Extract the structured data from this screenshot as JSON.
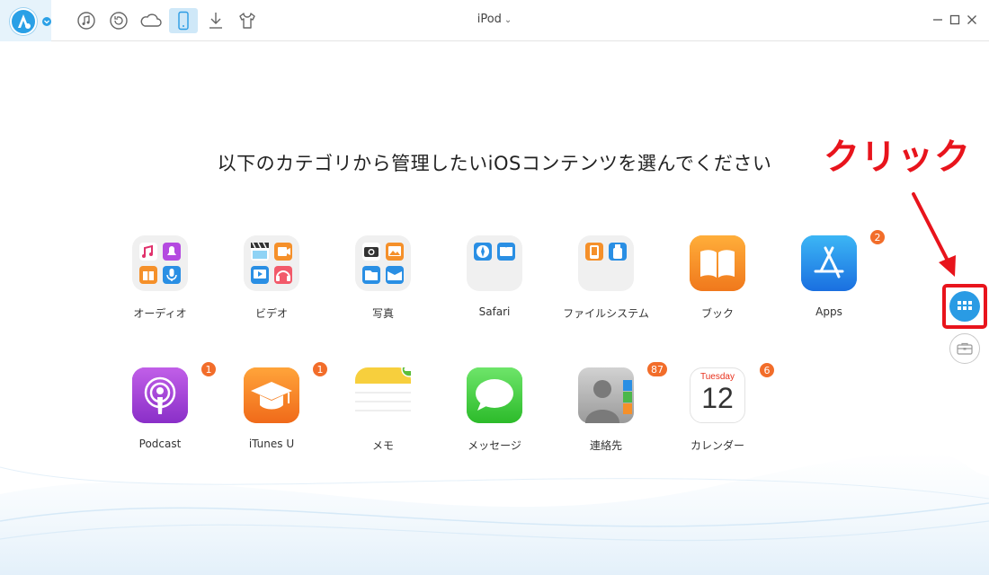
{
  "titlebar": {
    "device_name": "iPod",
    "toolbar": [
      {
        "name": "music-icon",
        "active": false
      },
      {
        "name": "restore-icon",
        "active": false
      },
      {
        "name": "cloud-icon",
        "active": false
      },
      {
        "name": "device-icon",
        "active": true
      },
      {
        "name": "download-icon",
        "active": false
      },
      {
        "name": "tshirt-icon",
        "active": false
      }
    ]
  },
  "main": {
    "heading": "以下のカテゴリから管理したいiOSコンテンツを選んでください",
    "categories": [
      {
        "label": "オーディオ",
        "icon": "audio-folder-icon",
        "badge": ""
      },
      {
        "label": "ビデオ",
        "icon": "video-folder-icon",
        "badge": ""
      },
      {
        "label": "写真",
        "icon": "photo-folder-icon",
        "badge": ""
      },
      {
        "label": "Safari",
        "icon": "safari-folder-icon",
        "badge": ""
      },
      {
        "label": "ファイルシステム",
        "icon": "filesystem-folder-icon",
        "badge": ""
      },
      {
        "label": "ブック",
        "icon": "books-icon",
        "badge": ""
      },
      {
        "label": "Apps",
        "icon": "app-store-icon",
        "badge": "2"
      },
      {
        "label": "Podcast",
        "icon": "podcast-icon",
        "badge": "1"
      },
      {
        "label": "iTunes U",
        "icon": "itunes-u-icon",
        "badge": "1"
      },
      {
        "label": "メモ",
        "icon": "notes-icon",
        "badge": ""
      },
      {
        "label": "メッセージ",
        "icon": "messages-icon",
        "badge": ""
      },
      {
        "label": "連絡先",
        "icon": "contacts-icon",
        "badge": "87"
      },
      {
        "label": "カレンダー",
        "icon": "calendar-icon",
        "badge": "6"
      }
    ],
    "calendar": {
      "weekday": "Tuesday",
      "day": "12"
    }
  },
  "annotation": {
    "text": "クリック",
    "color": "#e8141c"
  },
  "colors": {
    "accent": "#2a9be4",
    "badge": "#f26d2a"
  }
}
